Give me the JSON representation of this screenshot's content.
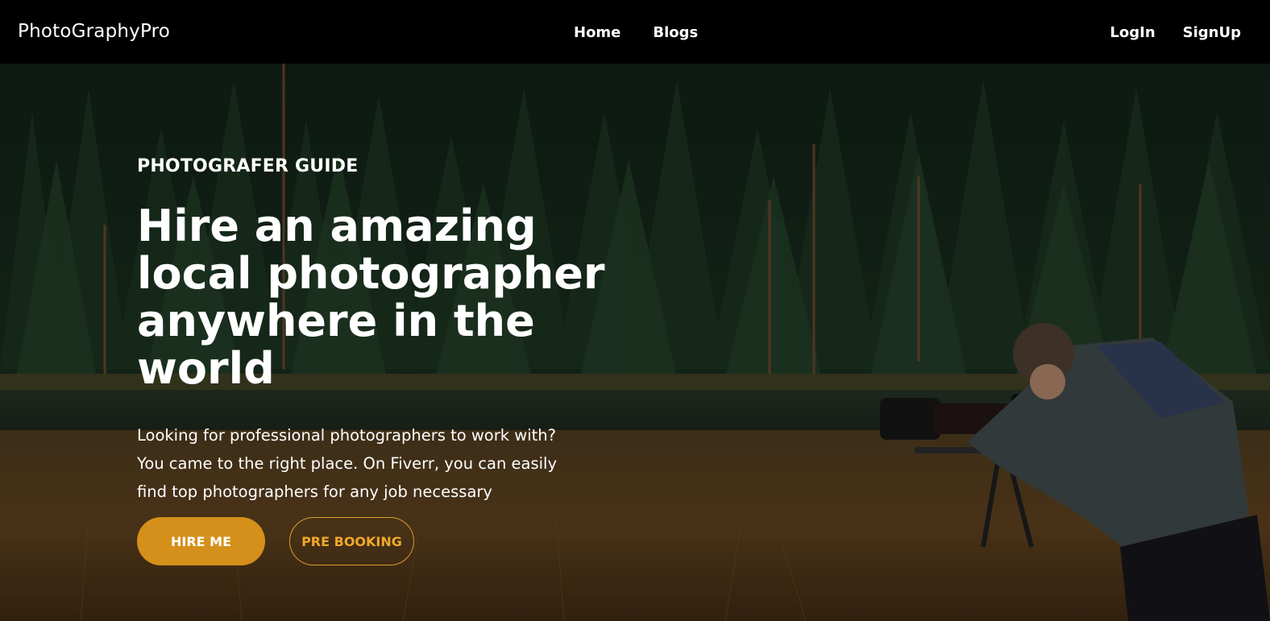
{
  "brand": "PhotoGraphyPro",
  "nav": {
    "center": [
      "Home",
      "Blogs"
    ],
    "right": [
      "LogIn",
      "SignUp"
    ]
  },
  "hero": {
    "eyebrow": "PHOTOGRAFER GUIDE",
    "headline_lines": [
      "Hire an amazing",
      "local photographer",
      "anywhere in the world"
    ],
    "description_lines": [
      "Looking for professional photographers to work with?",
      "You came to the right place. On Fiverr, you can easily",
      "find top photographers for any job necessary"
    ],
    "primary_button": "HIRE ME",
    "secondary_button": "PRE BOOKING"
  },
  "colors": {
    "accent": "#d4901a",
    "outline_accent": "#f0a92a",
    "navbar_bg": "#000000"
  }
}
